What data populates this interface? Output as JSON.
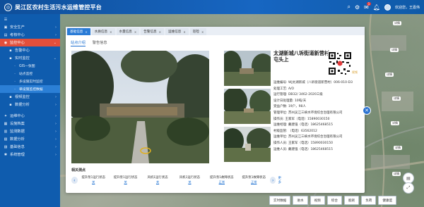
{
  "header": {
    "title": "吴江区农村生活污水运维管控平台",
    "user": "欢迎您，王嘉伟"
  },
  "sidebar": {
    "items": [
      {
        "label": "安全生产"
      },
      {
        "label": "考核中心"
      },
      {
        "label": "监控中心"
      },
      {
        "label": "告警中心"
      },
      {
        "label": "实时监控"
      },
      {
        "label": "GIS一张图"
      },
      {
        "label": "站点监控"
      },
      {
        "label": "多设施实时监控"
      },
      {
        "label": "单设施监控数据"
      },
      {
        "label": "视频监控"
      },
      {
        "label": "数据分析"
      },
      {
        "label": "运维中心"
      },
      {
        "label": "设施档案"
      },
      {
        "label": "监测数据"
      },
      {
        "label": "数据分析"
      },
      {
        "label": "基础信息"
      },
      {
        "label": "系统管理"
      }
    ]
  },
  "tabs": [
    {
      "label": "基础信息"
    },
    {
      "label": "水质信息"
    },
    {
      "label": "水量信息"
    },
    {
      "label": "告警信息"
    },
    {
      "label": "运维信息"
    },
    {
      "label": "巡检"
    }
  ],
  "subtabs": [
    {
      "label": "站点介绍"
    },
    {
      "label": "警告信息"
    }
  ],
  "station": {
    "name": "太湖新城八坼街道新营村屯头上",
    "hint": "视频",
    "info": [
      "运维编号: WJ太湖新城（八坼街道新营村）006-010-D3",
      "处理工艺: A/O",
      "运行管理: DB32/ 3462-2020三级",
      "设计日处理量: 10吨/天",
      "受益户数: 19户，98人",
      "管理单位: 苏州吴江三峡水环境综合治理有限公司",
      "操作员: 王家军（电话）15890030150",
      "运维经理: 戴建强（电话）18625468515",
      "村级监管: （电话）63562012",
      "运维单位: 苏州吴江三峡水环境综合治理有限公司",
      "操作人员: 王家军（电话）15890030150",
      "运维人员: 戴建强（电话）18625468515"
    ]
  },
  "related": {
    "title": "相关测点",
    "items": [
      {
        "name": "提升泵1运行状态",
        "status": "关"
      },
      {
        "name": "提升泵1运行状态",
        "status": "关"
      },
      {
        "name": "风机1运行状态",
        "status": "关"
      },
      {
        "name": "风机1运行状态",
        "status": "关"
      },
      {
        "name": "提升泵1故障状态",
        "status": "正常"
      },
      {
        "name": "提升泵1故障状态",
        "status": "正常"
      }
    ],
    "more": "更多"
  },
  "map_tags": [
    "详情",
    "详情",
    "详情",
    "详情",
    "详情",
    "详情",
    "详情"
  ],
  "bottom_buttons": [
    "实时数据",
    "进水",
    "视频",
    "综合",
    "能耗",
    "负荷",
    "健康度"
  ],
  "colors": {
    "header": "#1766c2",
    "sidebar": "#0f5cae",
    "active_menu": "#e24f3b",
    "accent": "#2a7bd6"
  }
}
